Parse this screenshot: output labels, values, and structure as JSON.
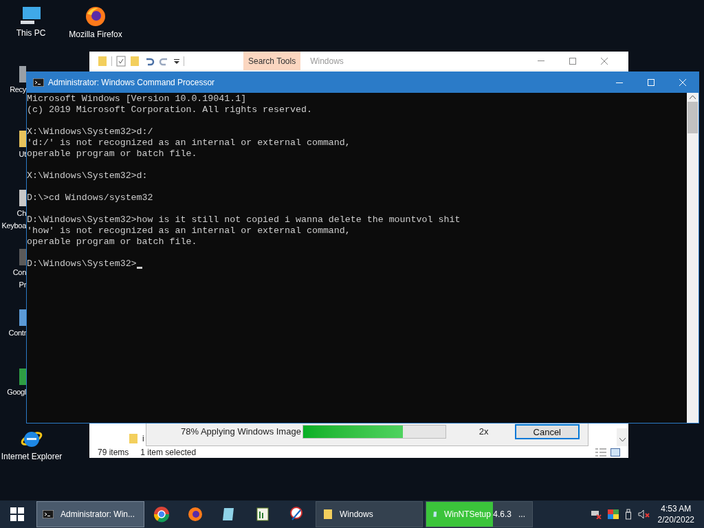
{
  "desktop_icons": [
    {
      "lines": [
        "This PC"
      ]
    },
    {
      "lines": [
        "Mozilla Firefox"
      ]
    },
    {
      "lines": [
        "Recy"
      ]
    },
    {
      "lines": [
        "Ut"
      ]
    },
    {
      "lines": [
        "Ch",
        "Keyboa"
      ]
    },
    {
      "lines": [
        "Con",
        "Pr"
      ]
    },
    {
      "lines": [
        "Contr"
      ]
    },
    {
      "lines": [
        "Googl"
      ]
    },
    {
      "lines": [
        "Internet Explorer"
      ]
    }
  ],
  "explorer": {
    "ribbon_tab": "Search Tools",
    "title": "Windows",
    "file": "i",
    "status_items": "79 items",
    "status_selected": "1 item selected"
  },
  "setup_dialog": {
    "status": "78% Applying Windows Image",
    "level": 0.7,
    "speed": "2x",
    "cancel": "Cancel"
  },
  "console": {
    "title": "Administrator: Windows Command Processor",
    "blocks": [
      [
        "Microsoft Windows [Version 10.0.19041.1]",
        "(c) 2019 Microsoft Corporation. All rights reserved."
      ],
      [
        "X:\\Windows\\System32>d:/",
        "'d:/' is not recognized as an internal or external command,",
        "operable program or batch file."
      ],
      [
        "X:\\Windows\\System32>d:"
      ],
      [
        "D:\\>cd Windows/system32"
      ],
      [
        "D:\\Windows\\System32>how is it still not copied i wanna delete the mountvol shit",
        "'how' is not recognized as an internal or external command,",
        "operable program or batch file."
      ],
      [
        "D:\\Windows\\System32>"
      ]
    ]
  },
  "taskbar": {
    "tasks": [
      {
        "label": "Administrator: Win...",
        "selected": true
      },
      {
        "label": "Windows",
        "selected": false
      },
      {
        "label": "WinNTSetup 4.6.3   ...",
        "selected": false,
        "level": 0.63
      }
    ],
    "time": "4:53 AM",
    "date": "2/20/2022"
  }
}
